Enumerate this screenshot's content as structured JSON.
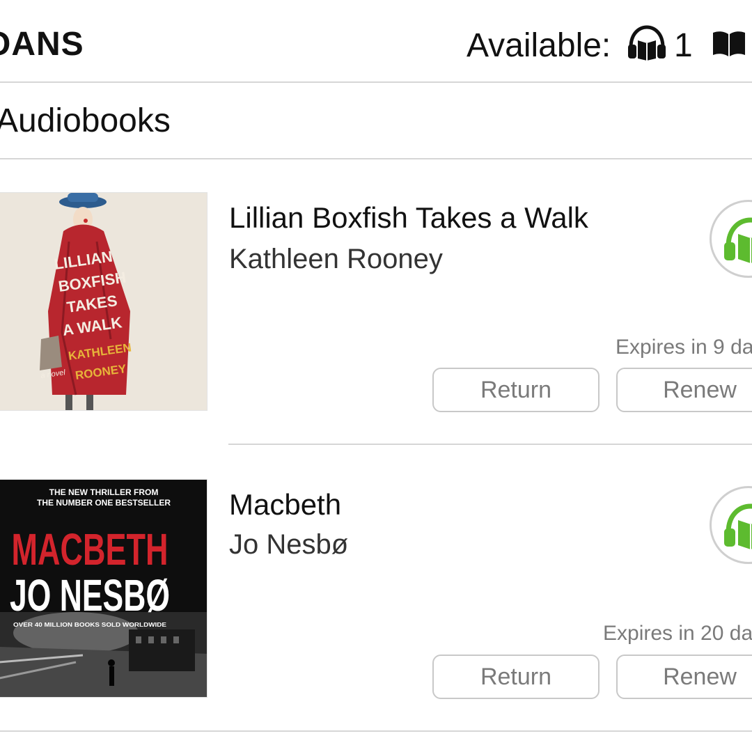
{
  "header": {
    "title": "OANS",
    "available_label": "Available:",
    "available_audiobooks_count": "1",
    "audiobook_icon": "headphones-icon",
    "ebook_icon": "open-book-icon"
  },
  "section": {
    "title": "Audiobooks"
  },
  "loans": [
    {
      "title": "Lillian Boxfish Takes a Walk",
      "author": "Kathleen Rooney",
      "expires": "Expires in 9 da",
      "return_label": "Return",
      "renew_label": "Renew",
      "cover_text": [
        "LILLIAN",
        "BOXFISH",
        "TAKES",
        "A WALK",
        "KATHLEEN",
        "ROONEY",
        "a novel"
      ],
      "status_icon": "green-audiobook-icon"
    },
    {
      "title": "Macbeth",
      "author": "Jo Nesbø",
      "expires": "Expires in 20 da",
      "return_label": "Return",
      "renew_label": "Renew",
      "cover_text": [
        "THE NEW THRILLER FROM",
        "THE NUMBER ONE BESTSELLER",
        "MACBETH",
        "JO NESBØ",
        "OVER 40 MILLION BOOKS SOLD WORLDWIDE"
      ],
      "status_icon": "green-audiobook-icon"
    }
  ],
  "colors": {
    "accent_green": "#5dbb2f",
    "divider": "#d6d6d6",
    "macbeth_red": "#d3242c"
  }
}
